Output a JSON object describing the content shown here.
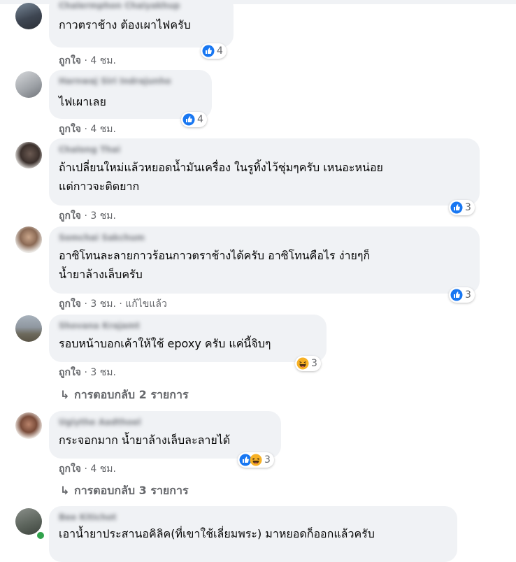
{
  "comments": [
    {
      "text": "กาวตราช้าง ต้องเผาไฟครับ",
      "author": "Chalermphon Chaiyakhup",
      "like": "ถูกใจ",
      "meta": " · 4 ชม.",
      "reactions": "4"
    },
    {
      "text": "ไฟเผาเลย",
      "author": "Harnwaj Siri Indrajunho",
      "like": "ถูกใจ",
      "meta": " · 4 ชม.",
      "reactions": "4"
    },
    {
      "text": "ถ้าเปลี่ยนใหม่แล้วหยอดน้ำมันเครื่อง ในรูทิ้งไว้ชุ่มๆครับ เหนอะหน่อย\nแต่กาวจะติดยาก",
      "author": "Chalong Thai",
      "like": "ถูกใจ",
      "meta": " · 3 ชม.",
      "reactions": "3"
    },
    {
      "text": "อาซิโทนละลายกาวร้อนกาวตราช้างได้ครับ อาซิโทนคือไร ง่ายๆก็\nน้ำยาล้างเล็บครับ",
      "author": "Somchai Sakchum",
      "like": "ถูกใจ",
      "meta": " · 3 ชม. · แก้ไขแล้ว",
      "reactions": "3"
    },
    {
      "text": "รอบหน้าบอกเค้าให้ใช้ epoxy ครับ แค่นี้จิบๆ",
      "author": "Shovana Krajamt",
      "like": "ถูกใจ",
      "meta": " · 3 ชม.",
      "reactions": "3",
      "replies": "การตอบกลับ 2 รายการ"
    },
    {
      "text": "กระจอกมาก น้ำยาล้างเล็บละลายได้",
      "author": "Ugiythe Aadthoel",
      "like": "ถูกใจ",
      "meta": " · 4 ชม.",
      "reactions": "3",
      "replies": "การตอบกลับ 3 รายการ"
    },
    {
      "text": "เอาน้ำยาประสานอคิลิค(ที่เขาใช้เลี่ยมพระ) มาหยอดก็ออกแล้วครับ",
      "author": "Bee Kitichot"
    }
  ],
  "colors": {
    "bubble": "#f0f2f5",
    "meta": "#65676b",
    "like_blue": "#1877f2",
    "haha_yellow": "#f7b125"
  },
  "icons": {
    "like": "thumbs-up-reaction-icon",
    "haha": "laughing-face-reaction-icon",
    "reply_arrow": "reply-arrow-icon"
  }
}
